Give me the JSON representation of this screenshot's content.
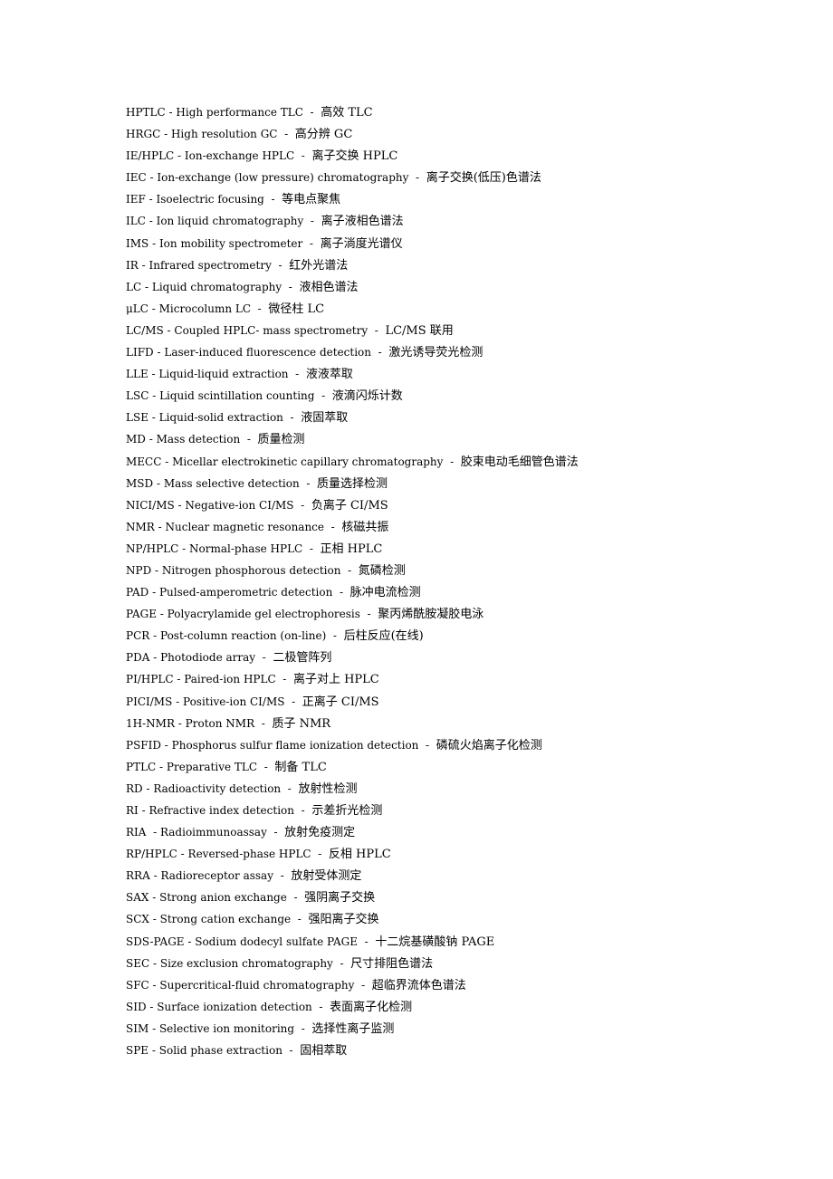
{
  "entries": [
    {
      "abbr": "HPTLC",
      "en": "High performance TLC",
      "zh": "高效 TLC"
    },
    {
      "abbr": "HRGC",
      "en": "High resolution GC",
      "zh": "高分辨 GC"
    },
    {
      "abbr": "IE/HPLC",
      "en": "Ion-exchange HPLC",
      "zh": "离子交换 HPLC"
    },
    {
      "abbr": "IEC",
      "en": "Ion-exchange (low pressure) chromatography",
      "zh": "离子交换(低压)色谱法"
    },
    {
      "abbr": "IEF",
      "en": "Isoelectric focusing",
      "zh": "等电点聚焦"
    },
    {
      "abbr": "ILC",
      "en": "Ion liquid chromatography",
      "zh": "离子液相色谱法"
    },
    {
      "abbr": "IMS",
      "en": "Ion mobility spectrometer",
      "zh": "离子淌度光谱仪"
    },
    {
      "abbr": "IR",
      "en": "Infrared spectrometry",
      "zh": "红外光谱法"
    },
    {
      "abbr": "LC",
      "en": "Liquid chromatography",
      "zh": "液相色谱法"
    },
    {
      "abbr": "μLC",
      "en": "Microcolumn LC",
      "zh": "微径柱 LC"
    },
    {
      "abbr": "LC/MS",
      "en": "Coupled HPLC- mass spectrometry",
      "zh": "LC/MS 联用"
    },
    {
      "abbr": "LIFD",
      "en": "Laser-induced fluorescence detection",
      "zh": "激光诱导荧光检测"
    },
    {
      "abbr": "LLE",
      "en": "Liquid-liquid extraction",
      "zh": "液液萃取"
    },
    {
      "abbr": "LSC",
      "en": "Liquid scintillation counting",
      "zh": "液滴闪烁计数"
    },
    {
      "abbr": "LSE",
      "en": "Liquid-solid extraction",
      "zh": "液固萃取"
    },
    {
      "abbr": "MD",
      "en": "Mass detection",
      "zh": "质量检测"
    },
    {
      "abbr": "MECC",
      "en": "Micellar electrokinetic capillary chromatography",
      "zh": "胶束电动毛细管色谱法"
    },
    {
      "abbr": "MSD",
      "en": "Mass selective detection",
      "zh": "质量选择检测"
    },
    {
      "abbr": "NICI/MS",
      "en": "Negative-ion CI/MS",
      "zh": "负离子 CI/MS"
    },
    {
      "abbr": "NMR",
      "en": "Nuclear magnetic resonance",
      "zh": "核磁共振"
    },
    {
      "abbr": "NP/HPLC",
      "en": "Normal-phase HPLC",
      "zh": "正相 HPLC"
    },
    {
      "abbr": "NPD",
      "en": "Nitrogen phosphorous detection",
      "zh": "氮磷检测"
    },
    {
      "abbr": "PAD",
      "en": "Pulsed-amperometric detection",
      "zh": "脉冲电流检测"
    },
    {
      "abbr": "PAGE",
      "en": "Polyacrylamide gel electrophoresis",
      "zh": "聚丙烯酰胺凝胶电泳"
    },
    {
      "abbr": "PCR",
      "en": "Post-column reaction (on-line)",
      "zh": "后柱反应(在线)"
    },
    {
      "abbr": "PDA",
      "en": "Photodiode array",
      "zh": "二极管阵列"
    },
    {
      "abbr": "PI/HPLC",
      "en": "Paired-ion HPLC",
      "zh": "离子对上 HPLC"
    },
    {
      "abbr": "PICI/MS",
      "en": "Positive-ion CI/MS",
      "zh": "正离子 CI/MS"
    },
    {
      "abbr": "1H-NMR",
      "en": "Proton NMR",
      "zh": "质子 NMR"
    },
    {
      "abbr": "PSFID",
      "en": "Phosphorus sulfur flame ionization detection",
      "zh": "磷硫火焰离子化检测"
    },
    {
      "abbr": "PTLC",
      "en": "Preparative TLC",
      "zh": "制备 TLC"
    },
    {
      "abbr": "RD",
      "en": "Radioactivity detection",
      "zh": "放射性检测"
    },
    {
      "abbr": "RI",
      "en": "Refractive index detection",
      "zh": "示差折光检测"
    },
    {
      "abbr": "RIA ",
      "en": "Radioimmunoassay",
      "zh": "放射免疫测定"
    },
    {
      "abbr": "RP/HPLC",
      "en": "Reversed-phase HPLC",
      "zh": "反相 HPLC"
    },
    {
      "abbr": "RRA",
      "en": "Radioreceptor assay",
      "zh": "放射受体测定"
    },
    {
      "abbr": "SAX",
      "en": "Strong anion exchange",
      "zh": "强阴离子交换"
    },
    {
      "abbr": "SCX",
      "en": "Strong cation exchange",
      "zh": "强阳离子交换"
    },
    {
      "abbr": "SDS-PAGE",
      "en": "Sodium dodecyl sulfate PAGE",
      "zh": "十二烷基磺酸钠 PAGE"
    },
    {
      "abbr": "SEC",
      "en": "Size exclusion chromatography",
      "zh": "尺寸排阻色谱法"
    },
    {
      "abbr": "SFC",
      "en": "Supercritical-fluid chromatography",
      "zh": "超临界流体色谱法"
    },
    {
      "abbr": "SID",
      "en": "Surface ionization detection",
      "zh": "表面离子化检测"
    },
    {
      "abbr": "SIM",
      "en": "Selective ion monitoring",
      "zh": "选择性离子监测"
    },
    {
      "abbr": "SPE",
      "en": "Solid phase extraction",
      "zh": "固相萃取"
    }
  ],
  "separator_1": " - ",
  "separator_2": "  -  "
}
